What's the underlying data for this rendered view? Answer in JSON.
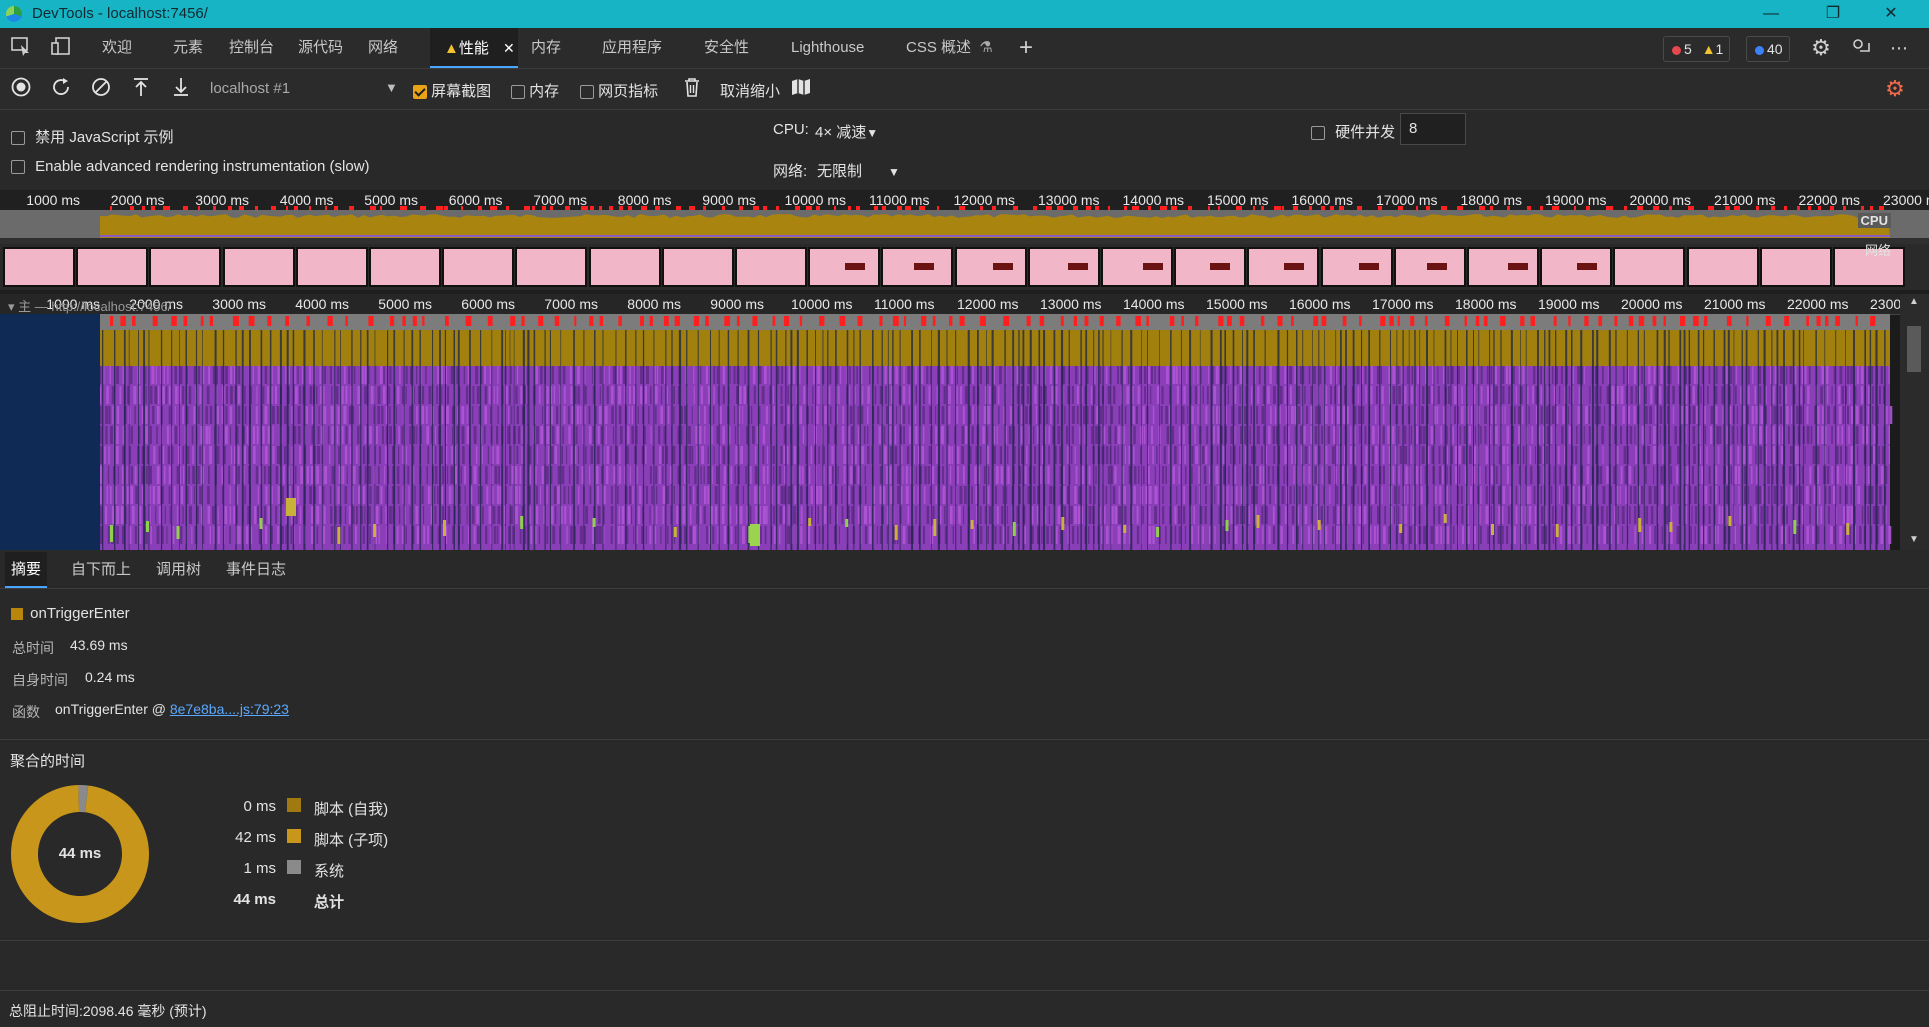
{
  "window": {
    "title": "DevTools - localhost:7456/"
  },
  "tabs": [
    {
      "label": "欢迎"
    },
    {
      "label": "元素"
    },
    {
      "label": "控制台"
    },
    {
      "label": "源代码"
    },
    {
      "label": "网络"
    },
    {
      "label": "性能",
      "active": true
    },
    {
      "label": "内存"
    },
    {
      "label": "应用程序"
    },
    {
      "label": "安全性"
    },
    {
      "label": "Lighthouse"
    },
    {
      "label": "CSS 概述"
    }
  ],
  "issues": {
    "errors": "5",
    "warnings": "1",
    "info": "40"
  },
  "toolbar": {
    "target": "localhost #1",
    "screenshots_label": "屏幕截图",
    "screenshots_checked": true,
    "memory_label": "内存",
    "memory_checked": false,
    "webvitals_label": "网页指标",
    "webvitals_checked": false,
    "unzoom_label": "取消缩小"
  },
  "settings": {
    "disable_js_samples": "禁用 JavaScript 示例",
    "advanced_rendering": "Enable advanced rendering instrumentation (slow)",
    "cpu_label": "CPU:",
    "cpu_value": "4× 减速",
    "network_label": "网络:",
    "network_value": "无限制",
    "hw_concurrency_label": "硬件并发",
    "hw_concurrency_value": "8"
  },
  "overview": {
    "ticks": [
      "1000 ms",
      "2000 ms",
      "3000 ms",
      "4000 ms",
      "5000 ms",
      "6000 ms",
      "7000 ms",
      "8000 ms",
      "9000 ms",
      "10000 ms",
      "11000 ms",
      "12000 ms",
      "13000 ms",
      "14000 ms",
      "15000 ms",
      "16000 ms",
      "17000 ms",
      "18000 ms",
      "19000 ms",
      "20000 ms",
      "21000 ms",
      "22000 ms",
      "23000 ms"
    ],
    "cpu_tag": "CPU",
    "network_tag": "网络"
  },
  "flame": {
    "ticks": [
      "1000 ms",
      "2000 ms",
      "3000 ms",
      "4000 ms",
      "5000 ms",
      "6000 ms",
      "7000 ms",
      "8000 ms",
      "9000 ms",
      "10000 ms",
      "11000 ms",
      "12000 ms",
      "13000 ms",
      "14000 ms",
      "15000 ms",
      "16000 ms",
      "17000 ms",
      "18000 ms",
      "19000 ms",
      "20000 ms",
      "21000 ms",
      "22000 ms",
      "23000 ms"
    ],
    "main_track_label": "主 — http://localhost:7456/"
  },
  "details_tabs": [
    {
      "label": "摘要",
      "active": true
    },
    {
      "label": "自下而上"
    },
    {
      "label": "调用树"
    },
    {
      "label": "事件日志"
    }
  ],
  "summary": {
    "event_name": "onTriggerEnter",
    "event_color": "#b8860b",
    "total_time_label": "总时间",
    "total_time_value": "43.69 ms",
    "self_time_label": "自身时间",
    "self_time_value": "0.24 ms",
    "function_label": "函数",
    "function_name": "onTriggerEnter @",
    "function_link": "8e7e8ba....js:79:23"
  },
  "aggregated": {
    "title": "聚合的时间",
    "donut_center": "44 ms",
    "rows": [
      {
        "value": "0 ms",
        "color": "#a07a10",
        "label": "脚本 (自我)"
      },
      {
        "value": "42 ms",
        "color": "#c8961a",
        "label": "脚本 (子项)"
      },
      {
        "value": "1 ms",
        "color": "#8a8a8a",
        "label": "系统"
      }
    ],
    "total_value": "44 ms",
    "total_label": "总计",
    "slices": [
      {
        "name": "脚本",
        "value": 43
      },
      {
        "name": "系统",
        "value": 1
      }
    ]
  },
  "status": {
    "blocking_time": "总阻止时间:2098.46 毫秒 (预计)"
  },
  "colors": {
    "accent": "#4aa3ff",
    "titlebar": "#17b4c6",
    "script": "#b8860b",
    "rendering": "#a25bd1",
    "long_task": "#ff1f1f"
  }
}
